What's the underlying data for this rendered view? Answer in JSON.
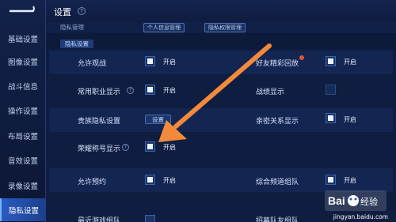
{
  "header": {
    "title": "设置"
  },
  "sidebar": {
    "items": [
      {
        "label": "基础设置"
      },
      {
        "label": "图像设置"
      },
      {
        "label": "战斗信息"
      },
      {
        "label": "操作设置"
      },
      {
        "label": "布局设置"
      },
      {
        "label": "音效设置"
      },
      {
        "label": "录像设置"
      },
      {
        "label": "隐私设置",
        "active": true
      }
    ]
  },
  "subtab": {
    "label": "隐私管理",
    "btn1": "个人信息管理",
    "btn2": "隐私权限管理"
  },
  "section": {
    "title": "隐私设置"
  },
  "settings": {
    "allow_watch": {
      "label": "允许观战",
      "state": "开启",
      "checked": true
    },
    "friend_replay": {
      "label": "好友精彩回放",
      "state": "开启",
      "checked": true
    },
    "show_job": {
      "label": "常用职业显示",
      "state": "开启",
      "checked": true
    },
    "battle_mark": {
      "label": "战绩显示",
      "checked": false
    },
    "noble_privacy": {
      "label": "贵族隐私设置",
      "button": "设置"
    },
    "intimacy_show": {
      "label": "亲密关系显示",
      "state": "开启",
      "checked": true
    },
    "honor_title": {
      "label": "荣耀称号显示",
      "state": "开启",
      "checked": true
    },
    "allow_reserve": {
      "label": "允许预约",
      "state": "开启",
      "checked": true
    },
    "channel_team": {
      "label": "综合频道组队",
      "state": "开启",
      "checked": true
    },
    "cut1": {
      "label": "最近游戏组队"
    },
    "cut2": {
      "label": "招募队友组队"
    }
  },
  "watermark": {
    "url": "jingyan.baidu.com",
    "logo": "Bai du 经验"
  },
  "colors": {
    "accent": "#f28a3c",
    "active_tab": "#2a5bc2"
  }
}
